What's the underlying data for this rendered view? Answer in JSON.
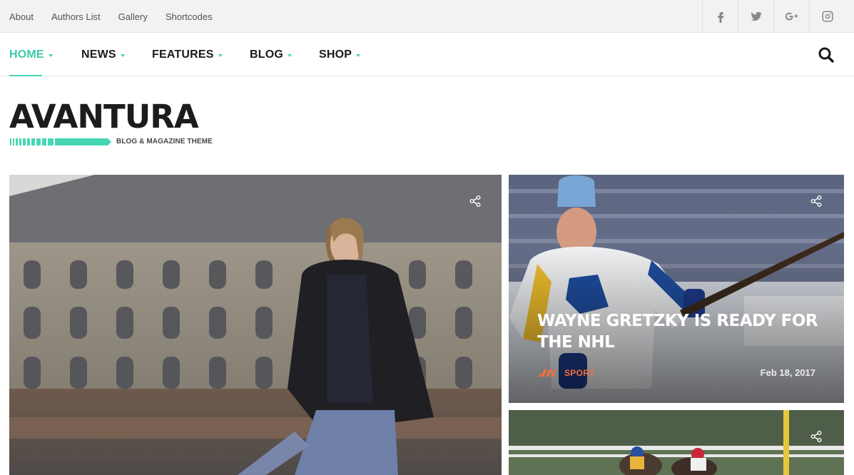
{
  "topbar": {
    "links": [
      "About",
      "Authors List",
      "Gallery",
      "Shortcodes"
    ],
    "social": [
      "facebook-icon",
      "twitter-icon",
      "google-plus-icon",
      "instagram-icon"
    ]
  },
  "nav": {
    "items": [
      "HOME",
      "NEWS",
      "FEATURES",
      "BLOG",
      "SHOP"
    ],
    "active": "HOME"
  },
  "logo": {
    "name": "AVANTURA",
    "tagline": "BLOG & MAGAZINE THEME"
  },
  "posts": [
    {
      "title": "",
      "category": "",
      "date": ""
    },
    {
      "title": "WAYNE GRETZKY IS READY FOR THE NHL",
      "category": "SPORT",
      "date": "Feb 18, 2017"
    },
    {
      "title": "",
      "category": "",
      "date": ""
    }
  ],
  "colors": {
    "accent": "#47d6b4",
    "category": "#f2703a",
    "text_dark": "#1a1a1a"
  }
}
